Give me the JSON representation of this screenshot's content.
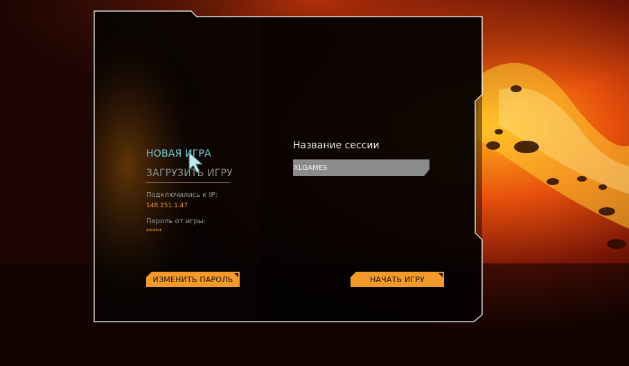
{
  "menu": {
    "new_game": "НОВАЯ ИГРА",
    "load_game": "ЗАГРУЗИТЬ ИГРУ"
  },
  "connection": {
    "ip_label": "Подключились к IP:",
    "ip_value": "148.251.1.47",
    "password_label": "Пароль от игры:",
    "password_value": "*****"
  },
  "session": {
    "title": "Название сессии",
    "name_value": "XLGAMES"
  },
  "buttons": {
    "change_password": "ИЗМЕНИТЬ ПАРОЛЬ",
    "start_game": "НАЧАТЬ ИГРУ"
  },
  "colors": {
    "accent_orange": "#f39a2b",
    "highlight_cyan": "#6fd8de",
    "frame_white": "#ffffff"
  }
}
